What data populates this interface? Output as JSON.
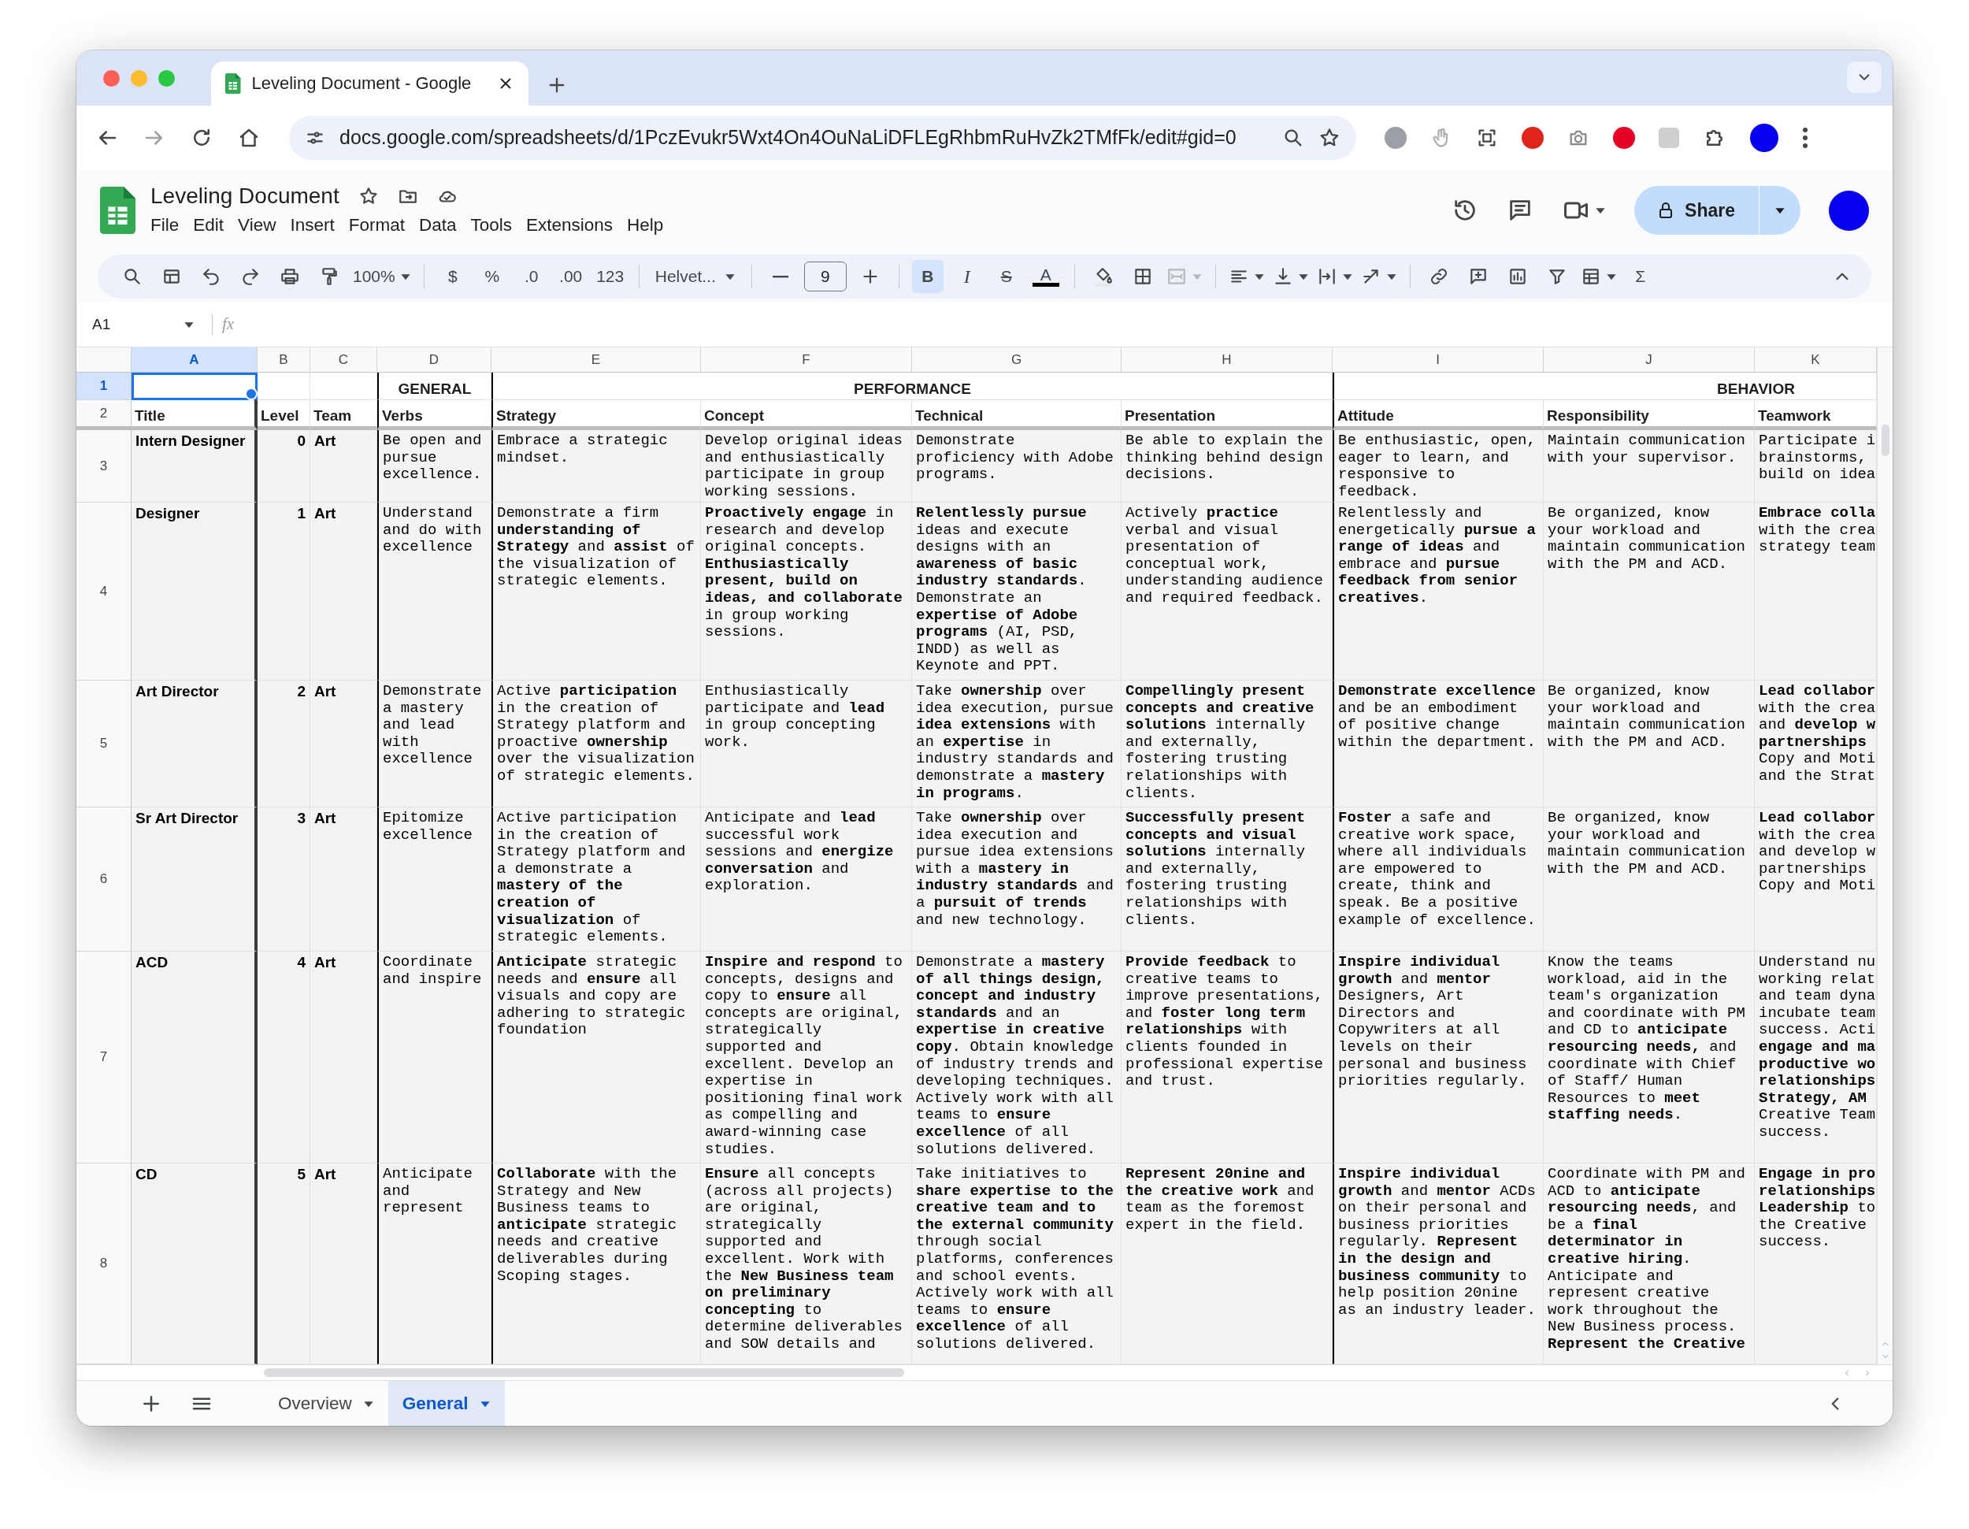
{
  "browser": {
    "tab_title": "Leveling Document - Google",
    "url": "docs.google.com/spreadsheets/d/1PczEvukr5Wxt4On4OuNaLiDFLEgRhbmRuHvZk2TMfFk/edit#gid=0"
  },
  "document": {
    "title": "Leveling Document",
    "menus": [
      "File",
      "Edit",
      "View",
      "Insert",
      "Format",
      "Data",
      "Tools",
      "Extensions",
      "Help"
    ],
    "share": "Share"
  },
  "toolbar": {
    "zoom": "100%",
    "currency": "$",
    "percent": "%",
    "decimal_decrease": ".0",
    "decimal_increase": ".00",
    "number_format": "123",
    "font": "Helvet...",
    "font_size": "9",
    "bold": {
      "label": "B",
      "on": true
    },
    "italic": "I",
    "strikethrough": "S",
    "text_color": "A",
    "merge_cells": {
      "disabled": true
    },
    "functions": "Σ"
  },
  "formula_bar": {
    "name_box": "A1",
    "fx": "fx"
  },
  "table": {
    "columns": [
      {
        "label": "A",
        "selected": true
      },
      {
        "label": "B",
        "selected": false
      },
      {
        "label": "C",
        "selected": false
      },
      {
        "label": "D",
        "selected": false
      },
      {
        "label": "E",
        "selected": false
      },
      {
        "label": "F",
        "selected": false
      },
      {
        "label": "G",
        "selected": false
      },
      {
        "label": "H",
        "selected": false
      },
      {
        "label": "I",
        "selected": false
      },
      {
        "label": "J",
        "selected": false
      },
      {
        "label": "K",
        "selected": false
      }
    ],
    "row_headers": [
      {
        "label": "1",
        "selected": true
      },
      {
        "label": "2",
        "selected": false
      },
      {
        "label": "3",
        "selected": false
      },
      {
        "label": "4",
        "selected": false
      },
      {
        "label": "5",
        "selected": false
      },
      {
        "label": "6",
        "selected": false
      },
      {
        "label": "7",
        "selected": false
      },
      {
        "label": "8",
        "selected": false
      }
    ],
    "group_headers": [
      "GENERAL",
      "PERFORMANCE",
      "BEHAVIOR"
    ],
    "field_headers": [
      "Title",
      "Level",
      "Team",
      "Verbs",
      "Strategy",
      "Concept",
      "Technical",
      "Presentation",
      "Attitude",
      "Responsibility",
      "Teamwork"
    ],
    "rows": [
      {
        "title": "Intern Designer",
        "level": "0",
        "team": "Art",
        "verbs": "Be open and pursue excellence.",
        "strategy": "Embrace a strategic mindset.",
        "concept": "Develop original ideas and enthusiastically participate in group working sessions.",
        "technical": "Demonstrate proficiency with Adobe programs.",
        "presentation": "Be able to explain the thinking behind design decisions.",
        "attitude": "Be enthusiastic, open, eager to learn, and responsive to feedback.",
        "responsibility": "Maintain communication with your supervisor.",
        "teamwork_lines": [
          "Participate i",
          "brainstorms,",
          "build on idea"
        ]
      },
      {
        "title": "Designer",
        "level": "1",
        "team": "Art",
        "verbs": "Understand and do with excellence",
        "strategy": "Demonstrate a firm **understanding of Strategy** and **assist** of the visualization of strategic elements.",
        "concept": "**Proactively engage** in research and develop original concepts. **Enthusiastically present, build on ideas, and collaborate** in group working sessions.",
        "technical": "**Relentlessly pursue** ideas and execute designs with an **awareness of basic industry standards**. Demonstrate an **expertise of Adobe programs** (AI, PSD, INDD) as well as Keynote and PPT.",
        "presentation": "Actively **practice** verbal and visual presentation of conceptual work, understanding audience and required feedback.",
        "attitude": "Relentlessly and energetically **pursue a range of ideas** and embrace and **pursue feedback from senior creatives**.",
        "responsibility": "Be organized, know your workload and maintain communication with the PM and ACD.",
        "teamwork_lines": [
          "**Embrace colla**",
          "with the crea",
          "strategy team"
        ]
      },
      {
        "title": "Art Director",
        "level": "2",
        "team": "Art",
        "verbs": "Demonstrate a mastery and lead with excellence",
        "strategy": "Active **participation** in the creation of Strategy platform and proactive **ownership** over the visualization of strategic elements.",
        "concept": "Enthusiastically participate and **lead** in group concepting work.",
        "technical": "Take **ownership** over idea execution, pursue **idea extensions** with an **expertise** in industry standards and demonstrate a **mastery in programs**.",
        "presentation": "**Compellingly present concepts and creative solutions** internally and externally, fostering trusting relationships with clients.",
        "attitude": "**Demonstrate excellence** and be an embodiment of positive change within the department.",
        "responsibility": "Be organized, know your workload and maintain communication with the PM and ACD.",
        "teamwork_lines": [
          "**Lead collabor**",
          "with the crea",
          "and **develop w**",
          "**partnerships**",
          "Copy and Moti",
          "and the Strat"
        ]
      },
      {
        "title": "Sr Art Director",
        "level": "3",
        "team": "Art",
        "verbs": "Epitomize excellence",
        "strategy": "Active participation in the creation of Strategy platform and a demonstrate a **mastery of the creation of visualization** of strategic elements.",
        "concept": "Anticipate and **lead** successful work sessions and **energize conversation** and exploration.",
        "technical": "Take **ownership** over idea execution and pursue idea extensions with a **mastery in industry standards** and a **pursuit of trends** and new technology.",
        "presentation": "**Successfully present concepts and visual solutions** internally and externally, fostering trusting relationships with clients.",
        "attitude": "**Foster** a safe and creative work space, where all individuals are empowered to create, think and speak. Be a positive example of excellence.",
        "responsibility": "Be organized, know your workload and maintain communication with the PM and ACD.",
        "teamwork_lines": [
          "**Lead collabor**",
          "with the crea",
          "and develop w",
          "partnerships",
          "Copy and Moti"
        ]
      },
      {
        "title": "ACD",
        "level": "4",
        "team": "Art",
        "verbs": "Coordinate and inspire",
        "strategy": "**Anticipate** strategic needs and **ensure** all visuals and copy are adhering to strategic foundation",
        "concept": "**Inspire and respond** to concepts, designs and copy to **ensure** all concepts are original, strategically supported and excellent. Develop an expertise in positioning final work as compelling and award-winning case studies.",
        "technical": "Demonstrate a **mastery of all things design, concept and industry standards** and an **expertise in creative copy**. Obtain knowledge of industry trends and developing techniques. Actively work with all teams to **ensure excellence** of all solutions delivered.",
        "presentation": "**Provide feedback** to creative teams to improve presentations, and **foster long term relationships** with clients founded in professional expertise and trust.",
        "attitude": "**Inspire individual growth** and **mentor** Designers, Art Directors and Copywriters at all levels on their personal and business priorities regularly.",
        "responsibility": "Know the teams workload, aid in the team's organization and coordinate with PM and CD to **anticipate resourcing needs,** and coordinate with Chief of Staff/ Human Resources to **meet staffing needs**.",
        "teamwork_lines": [
          "Understand nu",
          "working relat",
          "and team dyna",
          "incubate team",
          "success. Acti",
          "**engage and ma**",
          "**productive wo**",
          "**relationships**",
          "**Strategy, AM**",
          "Creative Team",
          "success."
        ]
      },
      {
        "title": "CD",
        "level": "5",
        "team": "Art",
        "verbs": "Anticipate and represent",
        "strategy": "**Collaborate** with the Strategy and New Business teams to **anticipate** strategic needs and creative deliverables during Scoping stages.",
        "concept": "**Ensure** all concepts (across all projects) are original, strategically supported and excellent. Work with the **New Business team on preliminary concepting** to determine deliverables and SOW details and",
        "technical": "Take initiatives to **share expertise to the creative team and to the external community** through social platforms, conferences and school events. Actively work with all teams to **ensure excellence** of all solutions delivered.",
        "presentation": "**Represent 20nine and the creative work** and team as the foremost expert in the field.",
        "attitude": "**Inspire individual growth** and **mentor** ACDs on their personal and business priorities regularly. **Represent in the design and business community** to help position 20nine as an industry leader.",
        "responsibility": "Coordinate with PM and ACD to **anticipate resourcing needs**, and be a **final determinator in creative hiring**. Anticipate and represent creative work throughout the New Business process. **Represent the Creative**",
        "teamwork_lines": [
          "**Engage in pro**",
          "**relationships**",
          "**Leadership** to",
          "the Creative",
          "success."
        ]
      }
    ]
  },
  "sheets": [
    {
      "label": "Overview",
      "selected": false
    },
    {
      "label": "General",
      "selected": true
    }
  ]
}
